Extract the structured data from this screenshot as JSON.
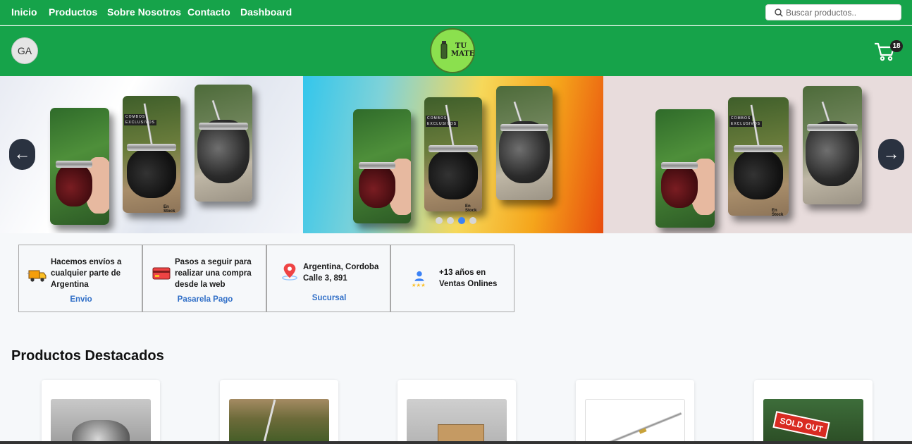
{
  "nav": {
    "links": [
      "Inicio",
      "Productos",
      "Sobre Nosotros",
      "Contacto",
      "Dashboard"
    ],
    "search_placeholder": "Buscar productos.."
  },
  "header": {
    "avatar_initials": "GA",
    "logo_text": "TU MATE",
    "cart_count": "18"
  },
  "carousel": {
    "stock_label": "En Stock",
    "prev_arrow": "←",
    "next_arrow": "→",
    "dot_count": 4,
    "active_dot": 3
  },
  "info_boxes": [
    {
      "text": "Hacemos envíos a cualquier parte de Argentina",
      "link": "Envio",
      "icon": "delivery-truck-icon"
    },
    {
      "text": "Pasos a seguir para realizar una compra desde la web",
      "link": "Pasarela Pago",
      "icon": "credit-card-icon"
    },
    {
      "text": "Argentina, Cordoba Calle 3, 891",
      "link": "Sucursal",
      "icon": "location-pin-icon"
    },
    {
      "text": "+13 años en Ventas Onlines",
      "link": "",
      "icon": "user-rating-icon"
    }
  ],
  "featured": {
    "title": "Productos Destacados",
    "sold_out_label": "SOLD OUT"
  },
  "colors": {
    "brand_green": "#16a34a",
    "link_blue": "#2f6ec7",
    "dot_active": "#3b82f6"
  }
}
